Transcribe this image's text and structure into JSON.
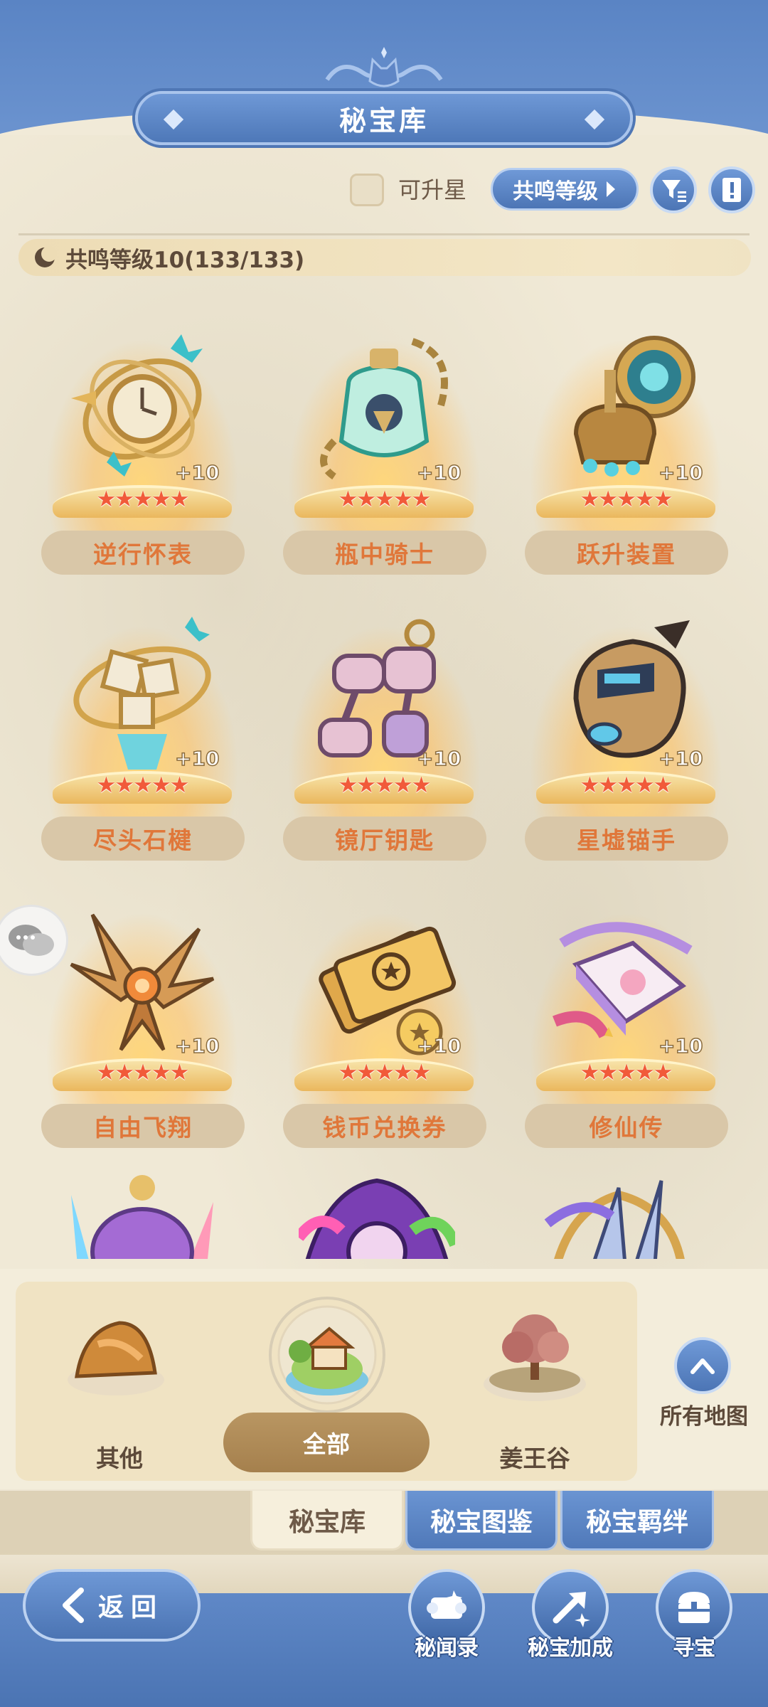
{
  "header": {
    "title": "秘宝库"
  },
  "toolbar": {
    "upgradable_label": "可升星",
    "level_sort_label": "共鸣等级"
  },
  "resonance": {
    "text": "共鸣等级10(133/133)"
  },
  "items": [
    {
      "name": "逆行怀表",
      "plus": "+10",
      "stars": "★★★★★",
      "star_count": 5,
      "icon": "pocket-watch-icon"
    },
    {
      "name": "瓶中骑士",
      "plus": "+10",
      "stars": "★★★★★",
      "star_count": 5,
      "icon": "knight-bottle-icon"
    },
    {
      "name": "跃升装置",
      "plus": "+10",
      "stars": "★★★★★",
      "star_count": 5,
      "icon": "device-icon"
    },
    {
      "name": "尽头石楗",
      "plus": "+10",
      "stars": "★★★★★",
      "star_count": 5,
      "icon": "stone-cube-icon"
    },
    {
      "name": "镜厅钥匙",
      "plus": "+10",
      "stars": "★★★★★",
      "star_count": 5,
      "icon": "key-chain-icon"
    },
    {
      "name": "星墟锚手",
      "plus": "+10",
      "stars": "★★★★★",
      "star_count": 5,
      "icon": "anchor-gauntlet-icon"
    },
    {
      "name": "自由飞翔",
      "plus": "+10",
      "stars": "★★★★★",
      "star_count": 5,
      "icon": "wings-icon"
    },
    {
      "name": "钱币兑换券",
      "plus": "+10",
      "stars": "★★★★★",
      "star_count": 5,
      "icon": "coupon-icon"
    },
    {
      "name": "修仙传",
      "plus": "+10",
      "stars": "★★★★★",
      "star_count": 5,
      "icon": "book-icon"
    }
  ],
  "regions": {
    "other": "其他",
    "all": "全部",
    "jiangwang": "姜王谷",
    "all_maps": "所有地图"
  },
  "tabs": {
    "vault": "秘宝库",
    "atlas": "秘宝图鉴",
    "bond": "秘宝羁绊"
  },
  "footer": {
    "back": "返回",
    "records": "秘闻录",
    "bonus": "秘宝加成",
    "hunt": "寻宝"
  }
}
